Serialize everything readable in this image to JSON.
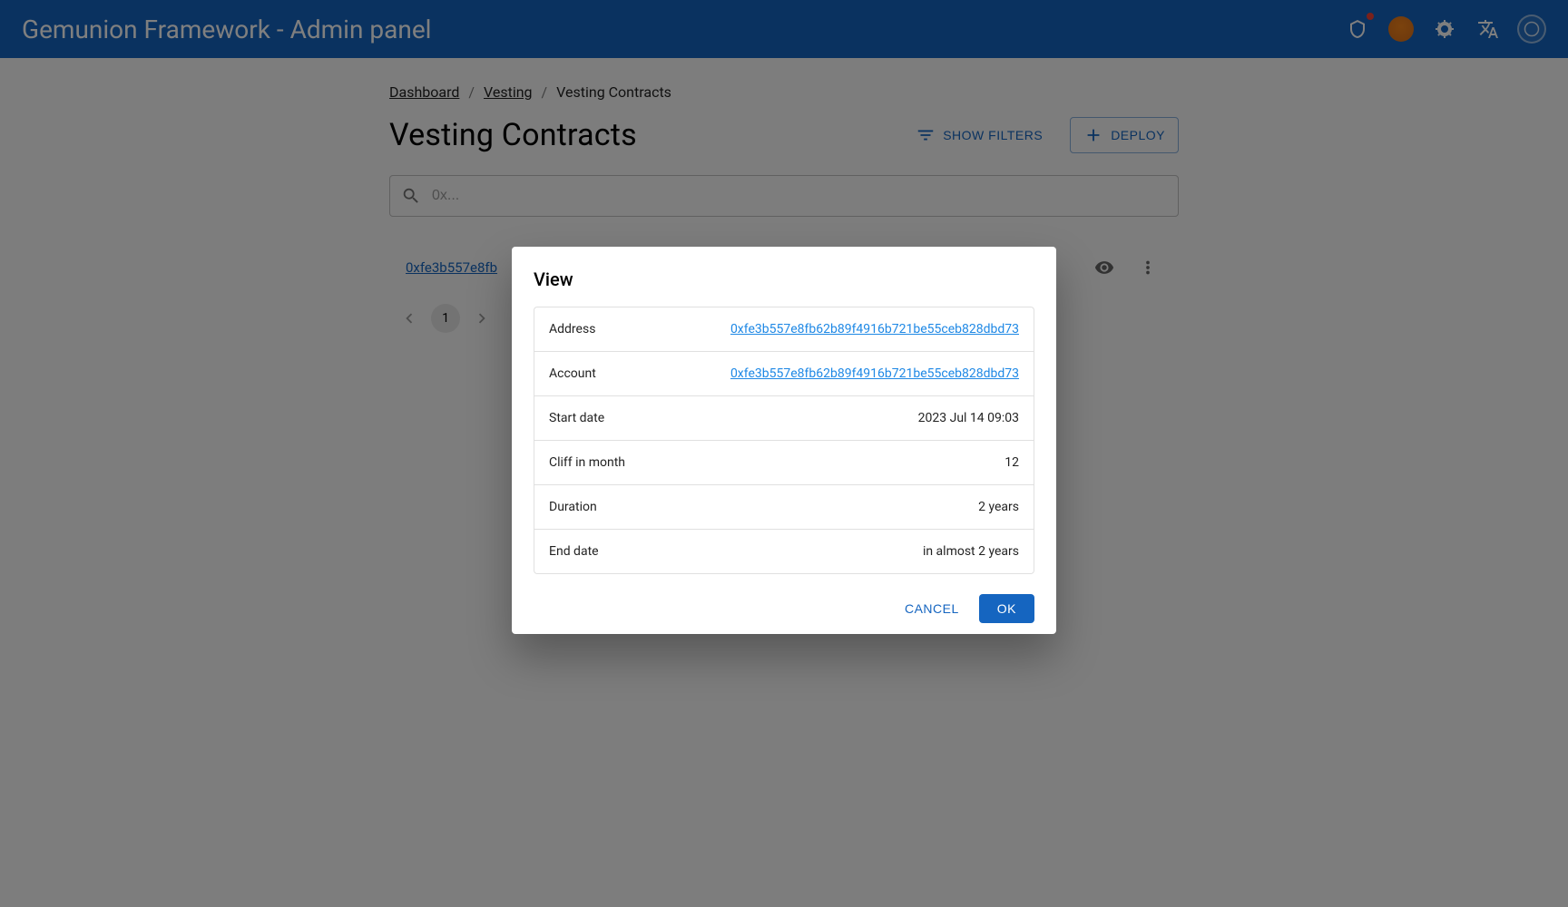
{
  "header": {
    "title": "Gemunion Framework - Admin panel"
  },
  "breadcrumb": {
    "dashboard": "Dashboard",
    "vesting": "Vesting",
    "current": "Vesting Contracts"
  },
  "page": {
    "title": "Vesting Contracts",
    "show_filters": "Show Filters",
    "deploy": "Deploy"
  },
  "search": {
    "placeholder": "0x..."
  },
  "list": {
    "items": [
      {
        "address": "0xfe3b557e8fb"
      }
    ]
  },
  "pagination": {
    "page": "1"
  },
  "dialog": {
    "title": "View",
    "rows": [
      {
        "label": "Address",
        "value": "0xfe3b557e8fb62b89f4916b721be55ceb828dbd73",
        "link": true
      },
      {
        "label": "Account",
        "value": "0xfe3b557e8fb62b89f4916b721be55ceb828dbd73",
        "link": true
      },
      {
        "label": "Start date",
        "value": "2023 Jul 14 09:03",
        "link": false
      },
      {
        "label": "Cliff in month",
        "value": "12",
        "link": false
      },
      {
        "label": "Duration",
        "value": "2 years",
        "link": false
      },
      {
        "label": "End date",
        "value": "in almost 2 years",
        "link": false
      }
    ],
    "cancel": "Cancel",
    "ok": "OK"
  }
}
